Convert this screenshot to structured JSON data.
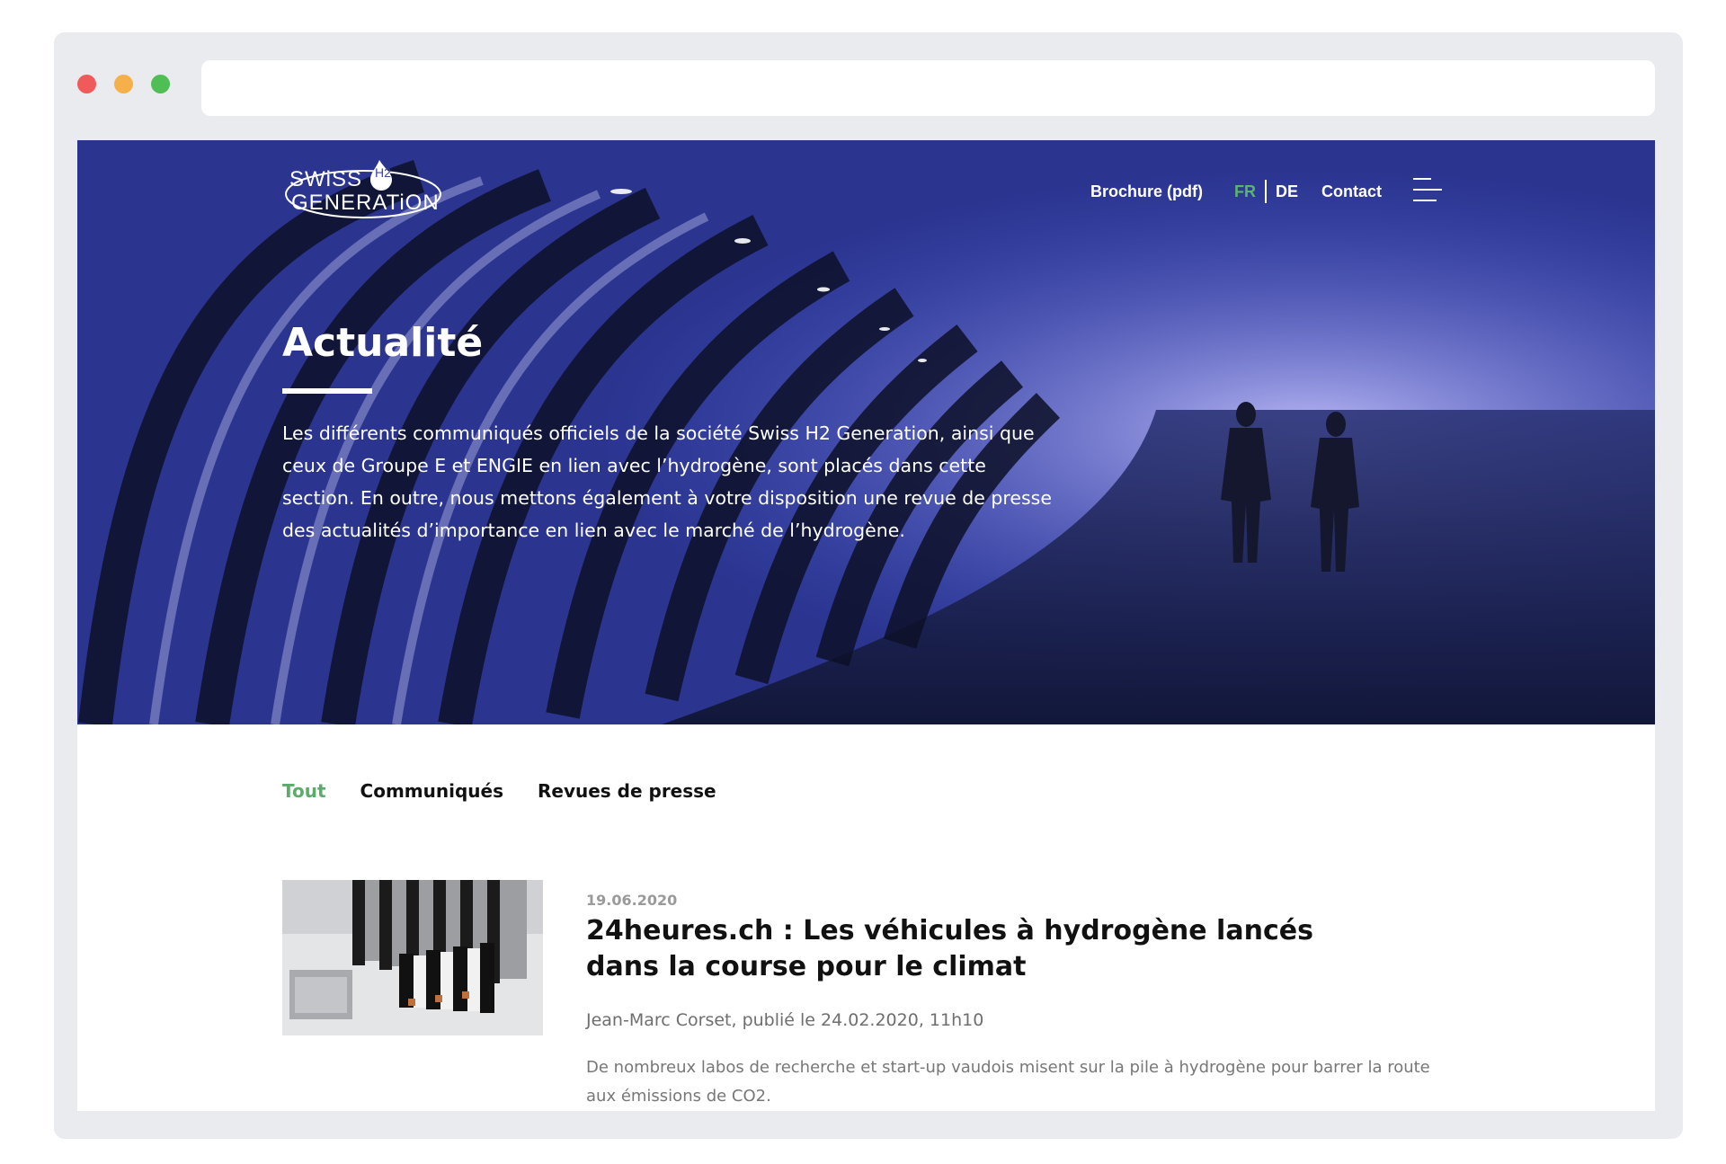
{
  "window": {
    "controls": [
      "close",
      "minimize",
      "maximize"
    ],
    "address_bar": ""
  },
  "header": {
    "logo": {
      "line1": "SWiSS",
      "h2": "H2",
      "line2": "GENERATiON"
    },
    "nav": {
      "brochure": "Brochure (pdf)",
      "lang_fr": "FR",
      "lang_de": "DE",
      "contact": "Contact"
    },
    "menu_icon": "hamburger-menu-icon"
  },
  "hero": {
    "title": "Actualité",
    "text": "Les différents communiqués officiels de la société Swiss H2 Generation, ainsi que ceux de Groupe E et ENGIE en lien avec l’hydrogène, sont placés dans cette section. En outre, nous mettons également à votre disposition une revue de presse des actualités d’importance en lien avec le marché de l’hydrogène."
  },
  "tabs": [
    {
      "label": "Tout",
      "active": true
    },
    {
      "label": "Communiqués",
      "active": false
    },
    {
      "label": "Revues de presse",
      "active": false
    }
  ],
  "articles": [
    {
      "date": "19.06.2020",
      "title": "24heures.ch : Les véhicules à hydrogène lancés dans la course pour le climat",
      "meta": "Jean-Marc Corset, publié le 24.02.2020, 11h10",
      "excerpt": "De nombreux labos de recherche et start-up vaudois misent sur la pile à hydrogène pour barrer la route aux émissions de CO2."
    }
  ],
  "colors": {
    "accent_green": "#5bab6b",
    "frame": "#e9ebef",
    "text_dark": "#111111",
    "text_muted": "#777777"
  }
}
